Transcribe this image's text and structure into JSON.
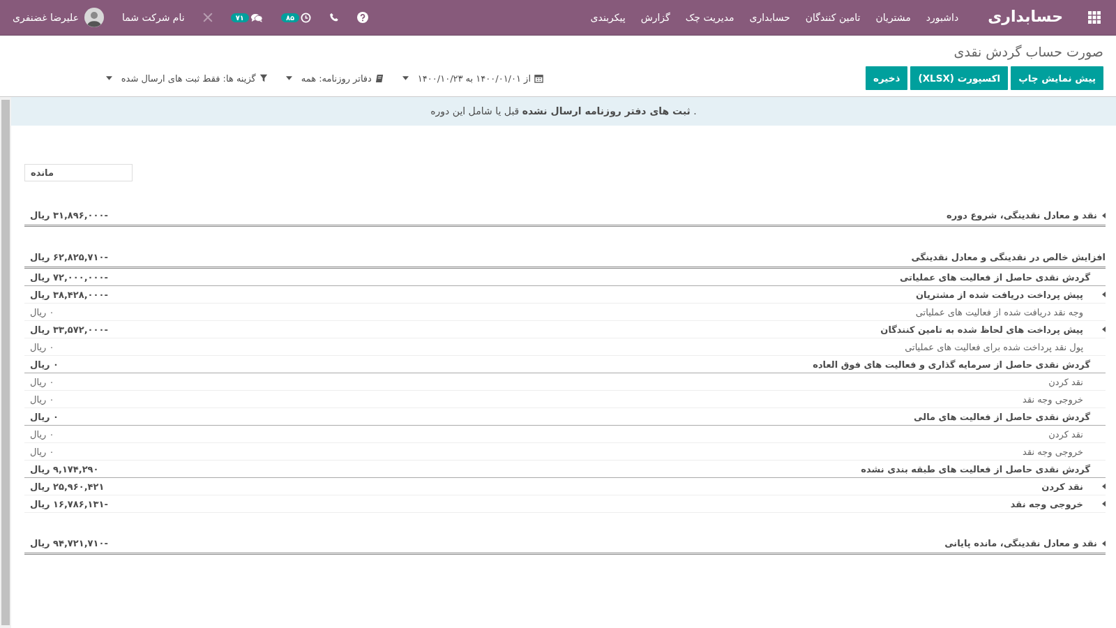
{
  "navbar": {
    "brand": "حسابداری",
    "menu": [
      "داشبورد",
      "مشتریان",
      "تامین کنندگان",
      "حسابداری",
      "مدیریت چک",
      "گزارش",
      "پیکربندی"
    ],
    "systray": [
      {
        "kind": "help"
      },
      {
        "kind": "phone"
      },
      {
        "kind": "activity",
        "badge": "۸۵"
      },
      {
        "kind": "chat",
        "badge": "۷۱"
      },
      {
        "kind": "tools"
      }
    ],
    "company": "نام شرکت شما",
    "user": "علیرضا غضنفری"
  },
  "control_panel": {
    "title": "صورت حساب گردش نقدی",
    "buttons": [
      "پیش نمایش چاپ",
      "اکسپورت (XLSX)",
      "ذخیره"
    ],
    "filters": [
      {
        "kind": "date",
        "label": "از ۱۴۰۰/۰۱/۰۱ به ۱۴۰۰/۱۰/۲۳"
      },
      {
        "kind": "journals",
        "label": "دفاتر روزنامه: همه"
      },
      {
        "kind": "options",
        "label": "گزینه ها: فقط ثبت های ارسال شده"
      }
    ]
  },
  "alert": ". **ثبت های دفتر روزنامه ارسال نشده** قبل یا شامل این دوره",
  "report": {
    "columns": [
      "مانده"
    ],
    "rows": [
      {
        "kind": "total",
        "expandable": true,
        "label": "نقد و معادل نقدینگی، شروع دوره",
        "amount": "-۳۱,۸۹۶,۰۰۰ ریال"
      },
      {
        "kind": "total",
        "expandable": false,
        "label": "افزایش خالص در نقدینگی و معادل نقدینگی",
        "amount": "-۶۲,۸۲۵,۷۱۰ ریال",
        "children": [
          {
            "kind": "section",
            "expandable": false,
            "label": "گردش نقدی حاصل از فعالیت های عملیاتی",
            "amount": "-۷۲,۰۰۰,۰۰۰ ریال",
            "children": [
              {
                "kind": "group",
                "expandable": true,
                "label": "پیش پرداخت دریافت شده از مشتریان",
                "amount": "-۳۸,۴۲۸,۰۰۰ ریال"
              },
              {
                "kind": "line",
                "expandable": false,
                "label": "وجه نقد دریافت شده از فعالیت های عملیاتی",
                "amount": "۰ ریال"
              },
              {
                "kind": "group",
                "expandable": true,
                "label": "پیش پرداخت های لحاظ شده به تامین کنندگان",
                "amount": "-۳۳,۵۷۲,۰۰۰ ریال"
              },
              {
                "kind": "line",
                "expandable": false,
                "label": "پول نقد پرداخت شده برای فعالیت های عملیاتی",
                "amount": "۰ ریال"
              }
            ]
          },
          {
            "kind": "section",
            "expandable": false,
            "label": "گردش نقدی حاصل از سرمایه گذاری و فعالیت های فوق العاده",
            "amount": "۰ ریال",
            "children": [
              {
                "kind": "line",
                "expandable": false,
                "label": "نقد کردن",
                "amount": "۰ ریال"
              },
              {
                "kind": "line",
                "expandable": false,
                "label": "خروجی وجه نقد",
                "amount": "۰ ریال"
              }
            ]
          },
          {
            "kind": "section",
            "expandable": false,
            "label": "گردش نقدی حاصل از فعالیت های مالی",
            "amount": "۰ ریال",
            "children": [
              {
                "kind": "line",
                "expandable": false,
                "label": "نقد کردن",
                "amount": "۰ ریال"
              },
              {
                "kind": "line",
                "expandable": false,
                "label": "خروجی وجه نقد",
                "amount": "۰ ریال"
              }
            ]
          },
          {
            "kind": "section",
            "expandable": false,
            "label": "گردش نقدی حاصل از فعالیت های طبقه بندی نشده",
            "amount": "۹,۱۷۴,۲۹۰ ریال",
            "children": [
              {
                "kind": "group",
                "expandable": true,
                "label": "نقد کردن",
                "amount": "۲۵,۹۶۰,۴۲۱ ریال"
              },
              {
                "kind": "group",
                "expandable": true,
                "label": "خروجی وجه نقد",
                "amount": "-۱۶,۷۸۶,۱۳۱ ریال"
              }
            ]
          }
        ]
      },
      {
        "kind": "total",
        "expandable": true,
        "label": "نقد و معادل نقدینگی، مانده پایانی",
        "amount": "-۹۴,۷۲۱,۷۱۰ ریال"
      }
    ]
  }
}
